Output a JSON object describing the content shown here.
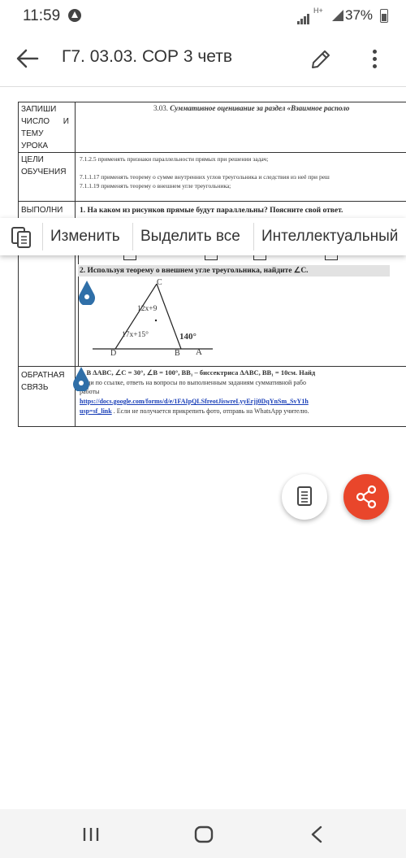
{
  "status": {
    "time": "11:59",
    "network": "H+",
    "battery": "37%"
  },
  "appbar": {
    "title": "Г7. 03.03. СОР 3 четв"
  },
  "context_menu": {
    "edit": "Изменить",
    "select_all": "Выделить все",
    "smart": "Интеллектуальный"
  },
  "document": {
    "row1_label": [
      "ЗАПИШИ",
      "ЧИСЛО      И",
      "ТЕМУ",
      "УРОКА"
    ],
    "row1_text_prefix": "3.03.",
    "row1_text": "Суммативное оценивание за раздел «Взаимное располо",
    "row2_label": [
      "ЦЕЛИ",
      "ОБУЧЕНИЯ"
    ],
    "goals": [
      "7.1.2.5 применять признаки параллельности прямых при решении задач;",
      "7.1.1.17 применять теорему о сумме внутренних углов треугольника и следствия из неё при реш",
      "7.1.1.19 применять теорему о внешнем угле треугольника;"
    ],
    "row3_label": "ВЫПОЛНИ",
    "task1": "1. На каком из рисунков прямые будут параллельны? Поясните свой ответ.",
    "task2": "2. Используя теорему о внешнем угле треугольника, найдите ∠C.",
    "figure": {
      "vertex_c": "C",
      "vertex_d": "D",
      "vertex_b": "B",
      "vertex_a": "A",
      "angle_c": "12x+9",
      "angle_d": "17x+15°",
      "angle_ext": "140°"
    },
    "task3_prefix": "3.",
    "task3_main": "В  ∆ABC, ∠C = 30°, ∠B = 100°, BB₁ – биссектриса  ∆ABC,  BB₁ = 10см. Найд",
    "row4_label": [
      "ОБРАТНАЯ",
      "СВЯЗЬ"
    ],
    "feedback_line1": "йди по ссылке,  ответь на вопросы по выполненным заданиям суммативной рабо",
    "feedback_line2": "работы",
    "feedback_url1": "https://docs.google.com/forms/d/e/1FAIpQLSfreotJiswreLyyErjj0DqYnSm_SvY1h",
    "feedback_url2": "usp=sf_link",
    "feedback_tail": ". Если не получается прикрепить фото, отправь на WhatsApp учителю."
  },
  "colors": {
    "fab_share": "#e9462b",
    "handle": "#2f6fa8",
    "link": "#1a3fb8"
  },
  "icons": [
    "back-arrow-icon",
    "pencil-icon",
    "more-vert-icon",
    "copy-icon",
    "doc-icon",
    "share-icon",
    "recents-icon",
    "home-icon",
    "back-icon"
  ]
}
